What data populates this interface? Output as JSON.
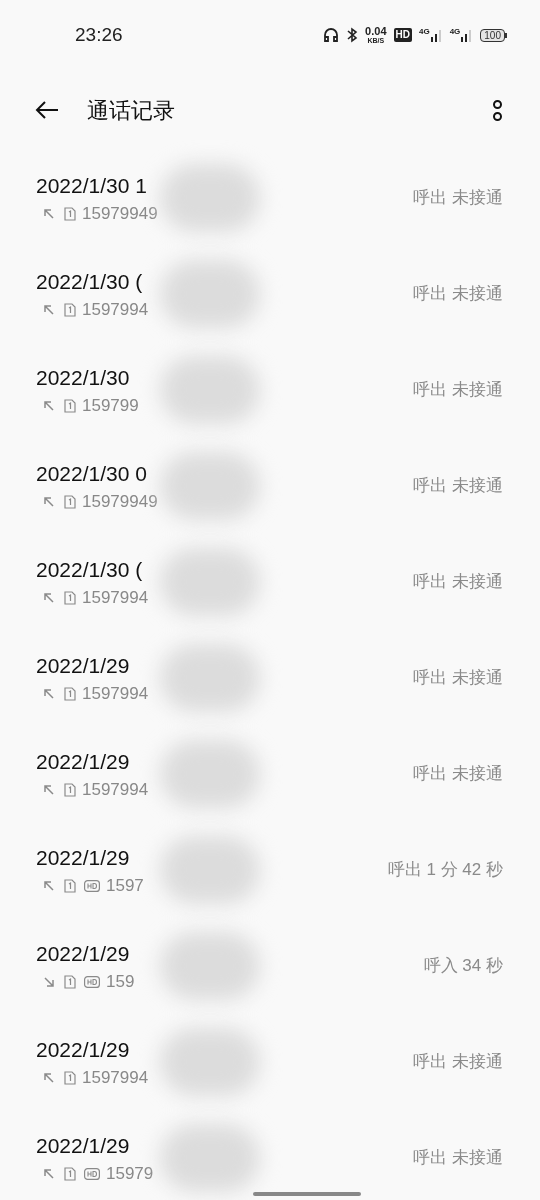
{
  "status_bar": {
    "time": "23:26",
    "speed": "0.04",
    "speed_unit": "KB/S",
    "hd": "HD",
    "network_1": "4G",
    "network_2": "4G",
    "battery": "100"
  },
  "header": {
    "title": "通话记录"
  },
  "calls": [
    {
      "date": "2022/1/30 1",
      "kind": "outgoing",
      "hd": false,
      "number": "15979949",
      "status": "呼出 未接通"
    },
    {
      "date": "2022/1/30 (",
      "kind": "outgoing",
      "hd": false,
      "number": "1597994",
      "status": "呼出 未接通"
    },
    {
      "date": "2022/1/30",
      "kind": "outgoing",
      "hd": false,
      "number": "159799",
      "status": "呼出 未接通"
    },
    {
      "date": "2022/1/30 0",
      "kind": "outgoing",
      "hd": false,
      "number": "15979949",
      "status": "呼出 未接通"
    },
    {
      "date": "2022/1/30 (",
      "kind": "outgoing",
      "hd": false,
      "number": "1597994",
      "status": "呼出 未接通"
    },
    {
      "date": "2022/1/29",
      "kind": "outgoing",
      "hd": false,
      "number": "1597994",
      "status": "呼出 未接通"
    },
    {
      "date": "2022/1/29",
      "kind": "outgoing",
      "hd": false,
      "number": "1597994",
      "status": "呼出 未接通"
    },
    {
      "date": "2022/1/29",
      "kind": "outgoing",
      "hd": true,
      "number": "1597",
      "status": "呼出 1 分 42 秒"
    },
    {
      "date": "2022/1/29",
      "kind": "incoming",
      "hd": true,
      "number": "159",
      "status": "呼入 34 秒"
    },
    {
      "date": "2022/1/29",
      "kind": "outgoing",
      "hd": false,
      "number": "1597994",
      "status": "呼出 未接通"
    },
    {
      "date": "2022/1/29",
      "kind": "outgoing",
      "hd": true,
      "number": "15979",
      "status": "呼出 未接通"
    }
  ]
}
